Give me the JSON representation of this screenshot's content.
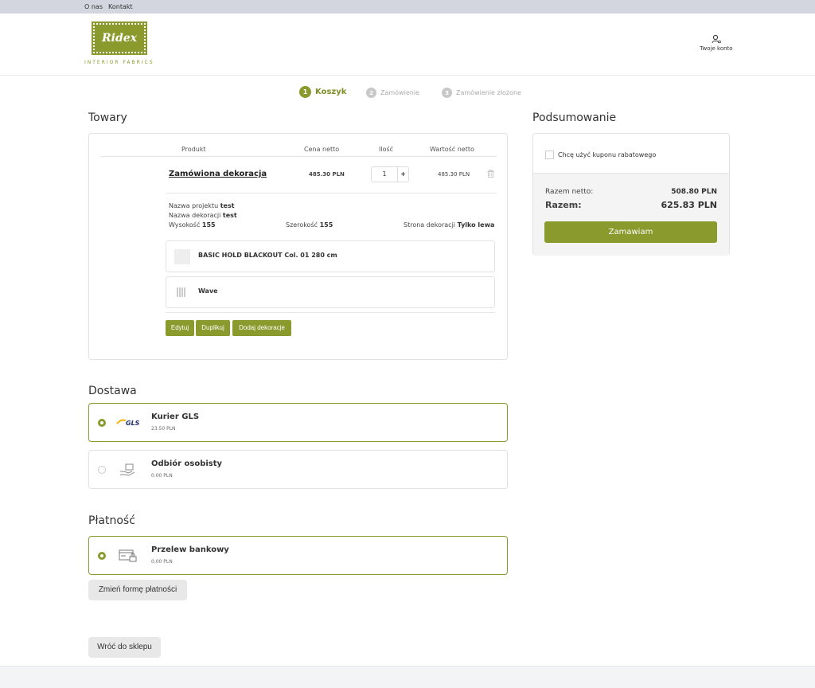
{
  "topbar": {
    "about": "O nas",
    "contact": "Kontakt"
  },
  "header": {
    "logo_text": "Ridex",
    "logo_sub": "INTERIOR FABRICS",
    "account_label": "Twoje konto"
  },
  "steps": [
    {
      "num": "1",
      "label": "Koszyk"
    },
    {
      "num": "2",
      "label": "Zamówienie"
    },
    {
      "num": "3",
      "label": "Zamówienie złożone"
    }
  ],
  "goods": {
    "title": "Towary",
    "columns": [
      "Produkt",
      "Cena netto",
      "Ilość",
      "Wartość netto"
    ],
    "item": {
      "name": "Zamówiona dekoracja",
      "price": "485.30 PLN",
      "qty": "1",
      "qty_plus": "+",
      "value": "485.30 PLN"
    },
    "details": {
      "project_label": "Nazwa projektu",
      "project_value": "test",
      "decoration_label": "Nazwa dekoracji",
      "decoration_value": "test",
      "height_label": "Wysokość",
      "height_value": "155",
      "width_label": "Szerokość",
      "width_value": "155",
      "side_label": "Strona dekoracji",
      "side_value": "Tylko lewa"
    },
    "components": [
      "BASIC HOLD BLACKOUT Col. 01 280 cm",
      "Wave"
    ],
    "buttons": {
      "edit": "Edytuj",
      "duplicate": "Duplikuj",
      "add": "Dodaj dekoracje"
    }
  },
  "delivery": {
    "title": "Dostawa",
    "options": [
      {
        "name": "Kurier GLS",
        "price": "23.50 PLN",
        "logo": "GLS"
      },
      {
        "name": "Odbiór osobisty",
        "price": "0.00 PLN"
      }
    ]
  },
  "payment": {
    "title": "Płatność",
    "option": {
      "name": "Przelew bankowy",
      "price": "0.00 PLN"
    },
    "change_label": "Zmień formę płatności"
  },
  "back_label": "Wróć do sklepu",
  "summary": {
    "title": "Podsumowanie",
    "coupon_label": "Chcę użyć kuponu rabatowego",
    "net_label": "Razem netto:",
    "net_value": "508.80 PLN",
    "total_label": "Razem:",
    "total_value": "625.83 PLN",
    "order_label": "Zamawiam"
  },
  "colors": {
    "accent": "#8a9a2c"
  }
}
